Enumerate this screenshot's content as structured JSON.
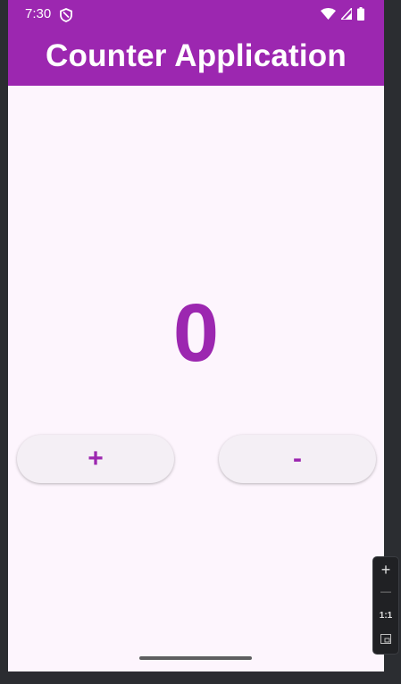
{
  "status_bar": {
    "time": "7:30",
    "background": "#9c27b0"
  },
  "app_bar": {
    "title": "Counter Application",
    "background": "#9c27b0"
  },
  "counter": {
    "value": "0",
    "color": "#9c27b0"
  },
  "buttons": {
    "increment_label": "+",
    "decrement_label": "-"
  },
  "zoom_controls": {
    "zoom_in": "+",
    "zoom_out": "—",
    "actual_size": "1:1"
  }
}
